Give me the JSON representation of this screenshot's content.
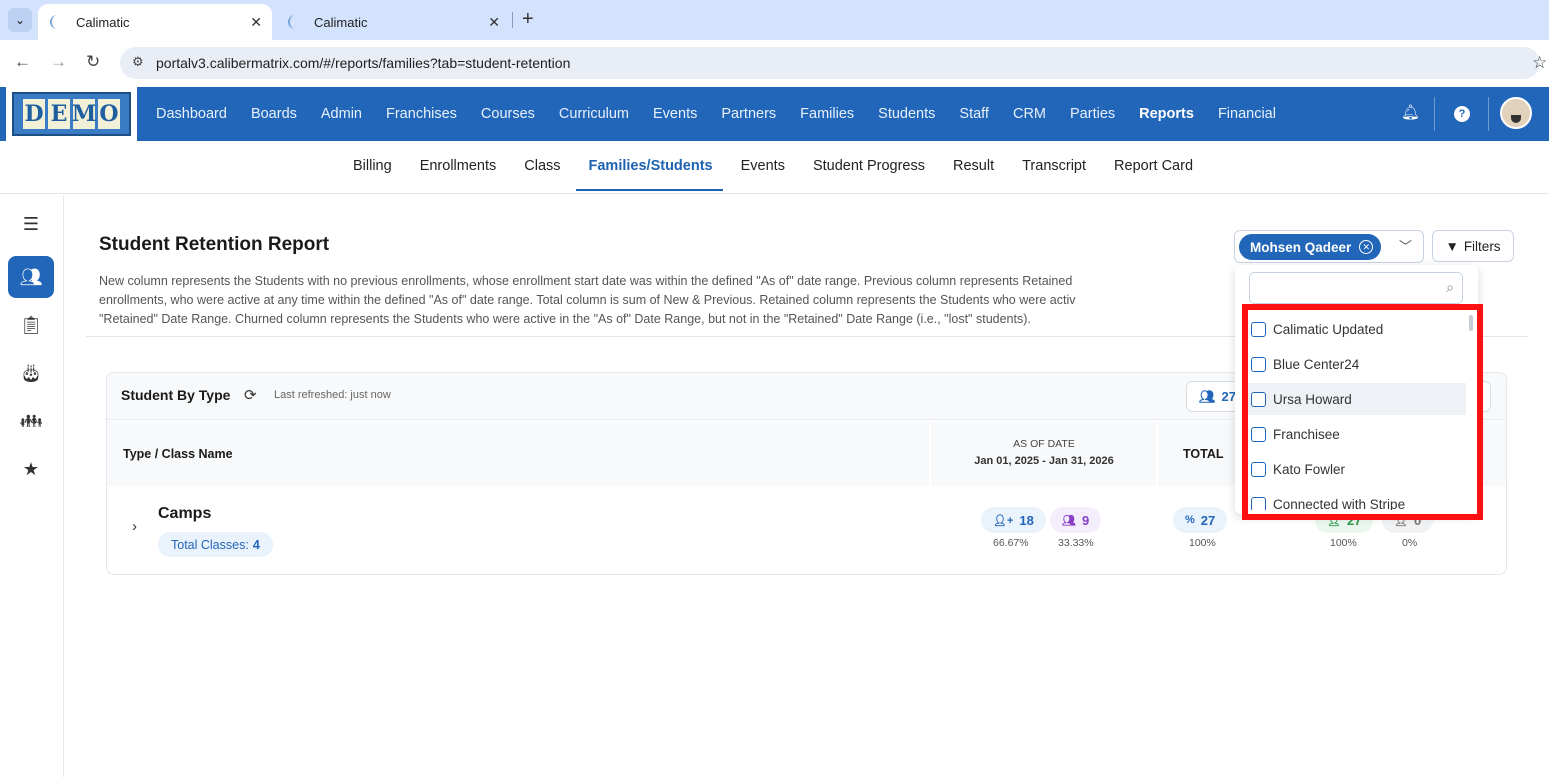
{
  "browser": {
    "tabs": [
      {
        "title": "Calimatic",
        "active": true
      },
      {
        "title": "Calimatic",
        "active": false
      }
    ],
    "url": "portalv3.calibermatrix.com/#/reports/families?tab=student-retention"
  },
  "header": {
    "logo_letters": [
      "D",
      "E",
      "M",
      "O"
    ],
    "nav": [
      "Dashboard",
      "Boards",
      "Admin",
      "Franchises",
      "Courses",
      "Curriculum",
      "Events",
      "Partners",
      "Families",
      "Students",
      "Staff",
      "CRM",
      "Parties",
      "Reports",
      "Financial"
    ],
    "active_nav": "Reports"
  },
  "subnav": {
    "items": [
      "Billing",
      "Enrollments",
      "Class",
      "Families/Students",
      "Events",
      "Student Progress",
      "Result",
      "Transcript",
      "Report Card"
    ],
    "active": "Families/Students"
  },
  "page": {
    "title": "Student Retention Report",
    "description": [
      "New column represents the Students with no previous enrollments, whose enrollment start date was within the defined \"As of\" date range. Previous column represents Retained",
      "enrollments, who were active at any time within the defined \"As of\" date range. Total column is sum of New & Previous. Retained column represents the Students who were activ",
      "\"Retained\" Date Range. Churned column represents the Students who were active in the \"As of\" Date Range, but not in the \"Retained\" Date Range (i.e., \"lost\" students)."
    ],
    "selected_chip": "Mohsen Qadeer",
    "filters_label": "Filters"
  },
  "card": {
    "title": "Student By Type",
    "last_refreshed": "Last refreshed: just now",
    "count_button": "27",
    "col_type": "Type / Class Name",
    "col_asof": "AS OF DATE",
    "col_asof_range": "Jan 01, 2025 - Jan 31, 2026",
    "col_total": "TOTAL",
    "row": {
      "name": "Camps",
      "badge_label": "Total Classes:",
      "badge_value": "4",
      "new_count": "18",
      "new_pct": "66.67%",
      "prev_count": "9",
      "prev_pct": "33.33%",
      "total_count": "27",
      "total_pct": "100%",
      "retained_count": "27",
      "retained_pct": "100%",
      "churned_count": "0",
      "churned_pct": "0%"
    }
  },
  "dropdown": {
    "search_placeholder": "",
    "options": [
      "Calimatic Updated",
      "Blue Center24",
      "Ursa Howard",
      "Franchisee",
      "Kato Fowler",
      "Connected with Stripe"
    ],
    "hovered": "Ursa Howard"
  },
  "colors": {
    "brand": "#2166b8",
    "highlight": "#ff1010"
  }
}
